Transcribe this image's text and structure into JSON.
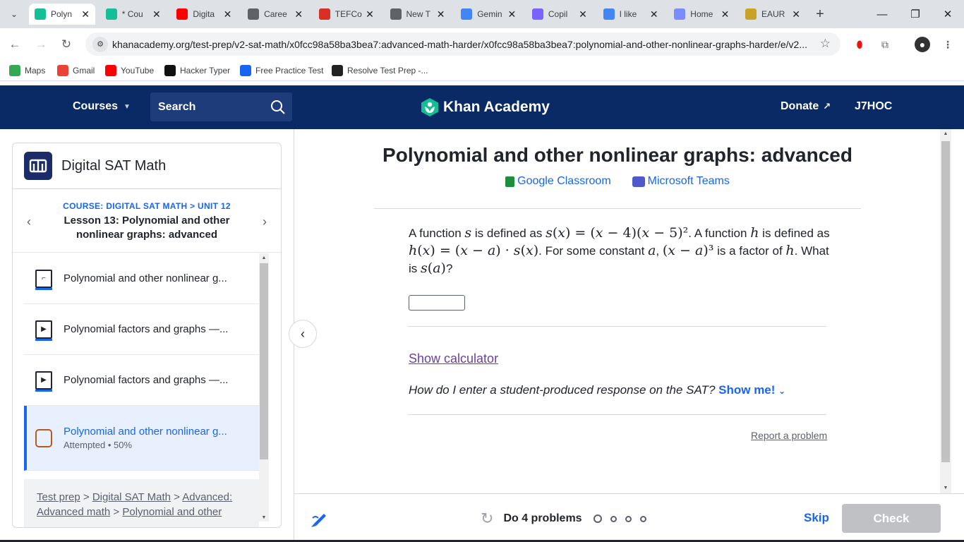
{
  "browser": {
    "tabs": [
      {
        "title": "Polyn",
        "icon": "khan-icon",
        "color": "#14bf96",
        "active": true
      },
      {
        "title": "* Cou",
        "icon": "khan-icon",
        "color": "#14bf96"
      },
      {
        "title": "Digita",
        "icon": "youtube-icon",
        "color": "#ff0000"
      },
      {
        "title": "Caree",
        "icon": "openai-icon",
        "color": "#5f6368"
      },
      {
        "title": "TEFCo",
        "icon": "tefc-icon",
        "color": "#d93025"
      },
      {
        "title": "New T",
        "icon": "chrome-icon",
        "color": "#5f6368"
      },
      {
        "title": "Gemin",
        "icon": "gemini-icon",
        "color": "#4285f4"
      },
      {
        "title": "Copil",
        "icon": "copilot-icon",
        "color": "#7b61ff"
      },
      {
        "title": "I like",
        "icon": "google-icon",
        "color": "#4285f4"
      },
      {
        "title": "Home",
        "icon": "home-icon",
        "color": "#7b8cff"
      },
      {
        "title": "EAUR",
        "icon": "eaur-icon",
        "color": "#c9a227"
      }
    ],
    "new_tab": "+",
    "url": "khanacademy.org/test-prep/v2-sat-math/x0fcc98a58ba3bea7:advanced-math-harder/x0fcc98a58ba3bea7:polynomial-and-other-nonlinear-graphs-harder/e/v2...",
    "bookmarks": [
      {
        "label": "Maps",
        "color": "#34a853"
      },
      {
        "label": "Gmail",
        "color": "#ea4335"
      },
      {
        "label": "YouTube",
        "color": "#ff0000"
      },
      {
        "label": "Hacker Typer",
        "color": "#111111"
      },
      {
        "label": "Free Practice Test",
        "color": "#1865f2"
      },
      {
        "label": "Resolve Test Prep -...",
        "color": "#222222"
      }
    ]
  },
  "header": {
    "courses": "Courses",
    "search": "Search",
    "logo": "Khan Academy",
    "donate": "Donate",
    "user": "J7HOC"
  },
  "sidebar": {
    "course_title": "Digital SAT Math",
    "crumb": "COURSE: DIGITAL SAT MATH > UNIT 12",
    "lesson_title": "Lesson 13: Polynomial and other nonlinear graphs: advanced",
    "items": [
      {
        "label": "Polynomial and other nonlinear g...",
        "icon": "article-icon"
      },
      {
        "label": "Polynomial factors and graphs —...",
        "icon": "video-icon"
      },
      {
        "label": "Polynomial factors and graphs —...",
        "icon": "video-icon"
      },
      {
        "label": "Polynomial and other nonlinear g...",
        "sub": "Attempted • 50%",
        "icon": "exercise-icon"
      }
    ],
    "footer": {
      "parts": [
        "Test prep",
        "Digital SAT Math",
        "Advanced: Advanced math",
        "Polynomial and other"
      ],
      "sep": ">"
    }
  },
  "main": {
    "title": "Polynomial and other nonlinear graphs: advanced",
    "google_classroom": "Google Classroom",
    "microsoft_teams": "Microsoft Teams",
    "question": {
      "t1": "A function ",
      "t2": " is defined as ",
      "t3": ". A function ",
      "t4": " is defined as ",
      "t5": ". For some constant ",
      "t6": ", ",
      "t7": " is a factor of ",
      "t8": ". What is ",
      "t9": "?"
    },
    "show_calculator": "Show calculator",
    "howto": "How do I enter a student-produced response on the SAT?",
    "show_me": "Show me!",
    "report": "Report a problem"
  },
  "footer": {
    "progress_label": "Do 4 problems",
    "problems_total": 4,
    "skip": "Skip",
    "check": "Check"
  },
  "colors": {
    "header_bg": "#0a2a66",
    "accent": "#1865f2",
    "check_disabled": "#bfc1c5"
  }
}
